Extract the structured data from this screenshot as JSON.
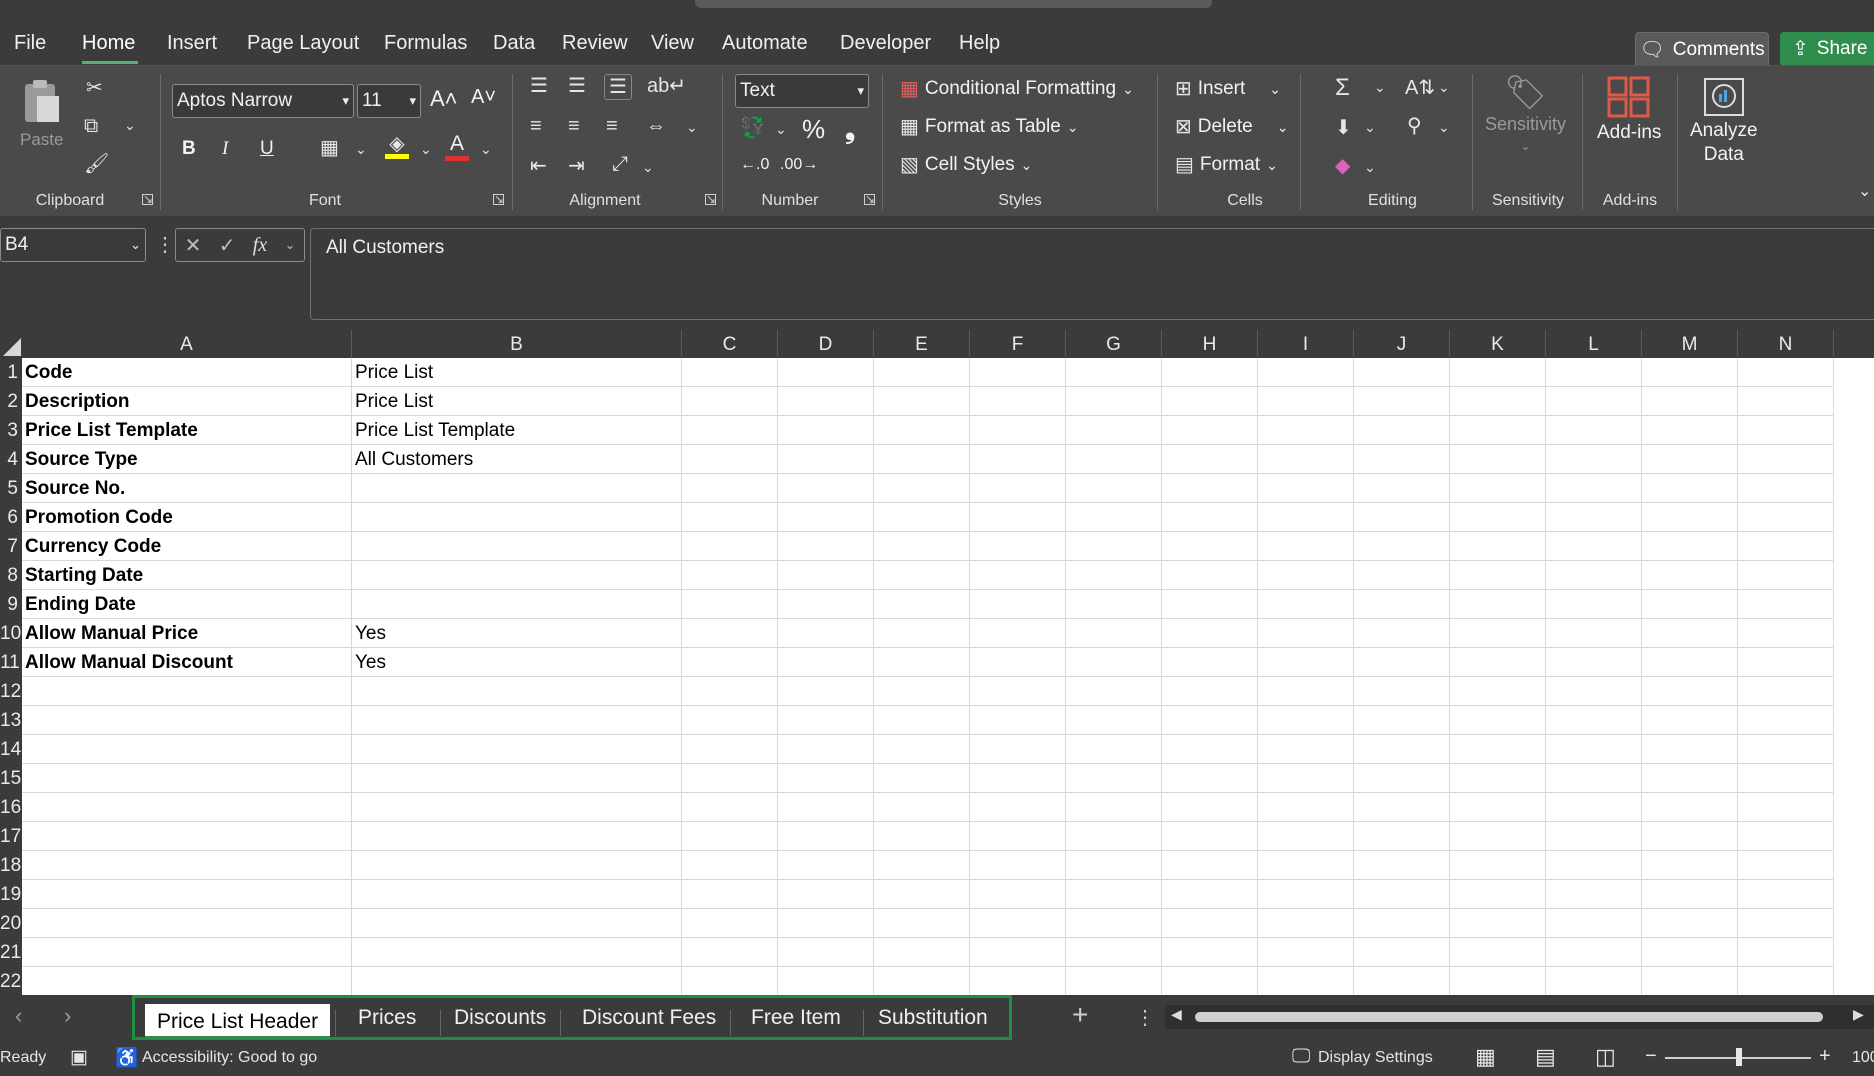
{
  "menu": {
    "items": [
      "File",
      "Home",
      "Insert",
      "Page Layout",
      "Formulas",
      "Data",
      "Review",
      "View",
      "Automate",
      "Developer",
      "Help"
    ],
    "active": "Home",
    "comments_label": "Comments",
    "share_label": "Share"
  },
  "ribbon": {
    "clipboard": {
      "paste_label": "Paste",
      "group_label": "Clipboard"
    },
    "font": {
      "font_name": "Aptos Narrow",
      "font_size": "11",
      "bold": "B",
      "italic": "I",
      "underline": "U",
      "group_label": "Font"
    },
    "alignment": {
      "group_label": "Alignment"
    },
    "number": {
      "format": "Text",
      "group_label": "Number"
    },
    "styles": {
      "conditional_formatting": "Conditional Formatting",
      "format_as_table": "Format as Table",
      "cell_styles": "Cell Styles",
      "group_label": "Styles"
    },
    "cells": {
      "insert": "Insert",
      "delete": "Delete",
      "format": "Format",
      "group_label": "Cells"
    },
    "editing": {
      "group_label": "Editing"
    },
    "sensitivity": {
      "label": "Sensitivity",
      "group_label": "Sensitivity"
    },
    "addins": {
      "label": "Add-ins",
      "group_label": "Add-ins"
    },
    "analyze": {
      "label_line1": "Analyze",
      "label_line2": "Data"
    }
  },
  "formula_bar": {
    "name_box": "B4",
    "fx": "fx",
    "content": "All Customers"
  },
  "grid": {
    "columns": [
      "A",
      "B",
      "C",
      "D",
      "E",
      "F",
      "G",
      "H",
      "I",
      "J",
      "K",
      "L",
      "M",
      "N"
    ],
    "row_numbers": [
      "1",
      "2",
      "3",
      "4",
      "5",
      "6",
      "7",
      "8",
      "9",
      "10",
      "11",
      "12",
      "13",
      "14",
      "15",
      "16",
      "17",
      "18",
      "19",
      "20",
      "21",
      "22"
    ],
    "rows": [
      [
        "Code",
        "Price List"
      ],
      [
        "Description",
        "Price List"
      ],
      [
        "Price List Template",
        "Price List Template"
      ],
      [
        "Source Type",
        "All Customers"
      ],
      [
        "Source No.",
        ""
      ],
      [
        "Promotion Code",
        ""
      ],
      [
        "Currency Code",
        ""
      ],
      [
        "Starting Date",
        ""
      ],
      [
        "Ending Date",
        ""
      ],
      [
        "Allow Manual Price",
        "Yes"
      ],
      [
        "Allow Manual Discount",
        "Yes"
      ]
    ]
  },
  "sheet_tabs": {
    "tabs": [
      "Price List Header",
      "Prices",
      "Discounts",
      "Discount Fees",
      "Free Item",
      "Substitution"
    ],
    "active": "Price List Header"
  },
  "status": {
    "ready": "Ready",
    "accessibility": "Accessibility: Good to go",
    "display_settings": "Display Settings",
    "zoom": "100"
  },
  "colors": {
    "accent_green": "#2f8e4e",
    "tab_outline_green": "#1e8f3f",
    "dark_bg": "#3b3b3b"
  }
}
